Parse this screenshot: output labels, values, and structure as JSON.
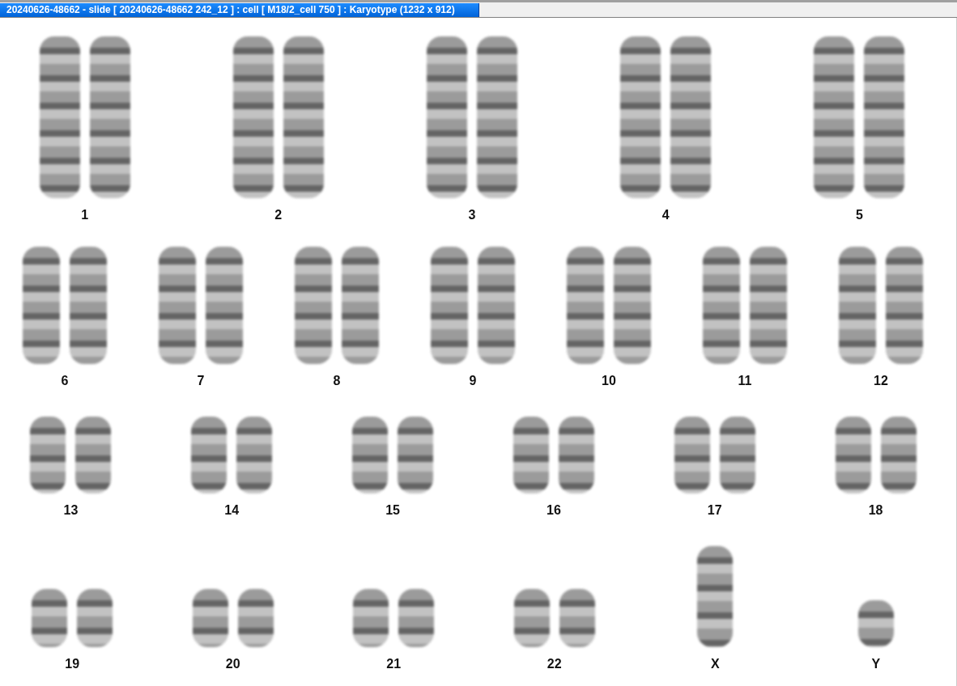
{
  "window": {
    "title": "20240626-48662 - slide [ 20240626-48662 242_12 ] : cell [ M18/2_cell 750 ] : Karyotype  (1232 x 912)"
  },
  "karyotype_rows": [
    [
      {
        "label": "1",
        "kind": "pair"
      },
      {
        "label": "2",
        "kind": "pair"
      },
      {
        "label": "3",
        "kind": "pair"
      },
      {
        "label": "4",
        "kind": "pair"
      },
      {
        "label": "5",
        "kind": "pair"
      }
    ],
    [
      {
        "label": "6",
        "kind": "pair"
      },
      {
        "label": "7",
        "kind": "pair"
      },
      {
        "label": "8",
        "kind": "pair"
      },
      {
        "label": "9",
        "kind": "pair"
      },
      {
        "label": "10",
        "kind": "pair"
      },
      {
        "label": "11",
        "kind": "pair"
      },
      {
        "label": "12",
        "kind": "pair"
      }
    ],
    [
      {
        "label": "13",
        "kind": "pair"
      },
      {
        "label": "14",
        "kind": "pair"
      },
      {
        "label": "15",
        "kind": "pair"
      },
      {
        "label": "16",
        "kind": "pair"
      },
      {
        "label": "17",
        "kind": "pair"
      },
      {
        "label": "18",
        "kind": "pair"
      }
    ],
    [
      {
        "label": "19",
        "kind": "pair"
      },
      {
        "label": "20",
        "kind": "pair"
      },
      {
        "label": "21",
        "kind": "pair"
      },
      {
        "label": "22",
        "kind": "pair"
      },
      {
        "label": "X",
        "kind": "single"
      },
      {
        "label": "Y",
        "kind": "single"
      }
    ]
  ]
}
